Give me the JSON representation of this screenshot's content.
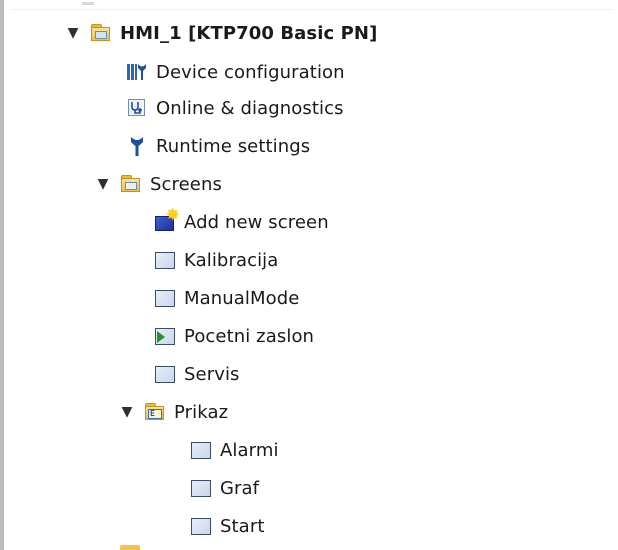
{
  "tree": {
    "device": {
      "label": "HMI_1 [KTP700 Basic PN]",
      "expanded": true,
      "icon": "hmi-folder-icon"
    },
    "device_items": [
      {
        "label": "Device configuration",
        "icon": "device-configuration-icon"
      },
      {
        "label": "Online & diagnostics",
        "icon": "online-diagnostics-icon"
      },
      {
        "label": "Runtime settings",
        "icon": "runtime-settings-wrench-icon"
      }
    ],
    "screens": {
      "label": "Screens",
      "expanded": true,
      "icon": "screens-folder-icon",
      "items": [
        {
          "label": "Add new screen",
          "icon": "add-new-screen-icon"
        },
        {
          "label": "Kalibracija",
          "icon": "screen-icon"
        },
        {
          "label": "ManualMode",
          "icon": "screen-icon"
        },
        {
          "label": "Pocetni zaslon",
          "icon": "start-screen-icon"
        },
        {
          "label": "Servis",
          "icon": "screen-icon"
        }
      ],
      "group": {
        "label": "Prikaz",
        "expanded": true,
        "icon": "screen-group-folder-icon",
        "items": [
          {
            "label": "Alarmi",
            "icon": "screen-icon"
          },
          {
            "label": "Graf",
            "icon": "screen-icon"
          },
          {
            "label": "Start",
            "icon": "screen-icon"
          }
        ]
      }
    }
  },
  "colors": {
    "accent_blue": "#2d66b8",
    "folder_yellow": "#f1bf45",
    "start_green": "#1a9a2a",
    "text": "#1a1a1a"
  }
}
